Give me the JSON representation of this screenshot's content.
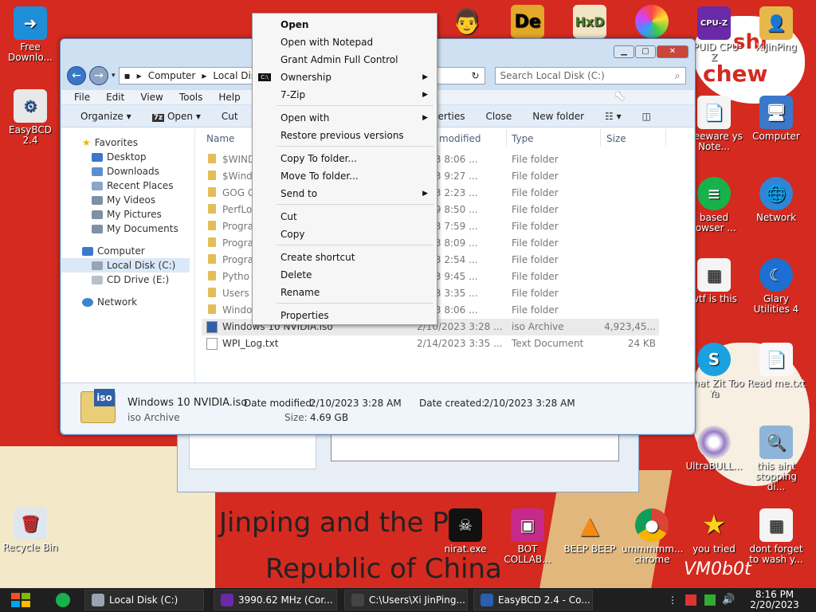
{
  "wallpaper": {
    "top_text_1": "shi",
    "top_text_2": "chew",
    "bottom_line_1": "Jinping and the P",
    "bottom_line_2": "Republic of China",
    "signature": "VM0b0t"
  },
  "desktop_icons": {
    "free_download": "Free Downlo...",
    "easybcd": "EasyBCD 2.4",
    "recycle_bin": "Recycle Bin",
    "cpuz": "CPUID CPU-Z",
    "xijinping": "XiJinPing",
    "freeware": "Freeware ys Note...",
    "computer": "Computer",
    "based_browser": "based rowser ...",
    "network": "Network",
    "wtf": "wtf is this",
    "glary": "Glary Utilities 4",
    "what_zit": "What Zit Too Ya",
    "readme": "Read me.txt",
    "ultrabull": "UltraBULL...",
    "this_aint": "this aint stopping di...",
    "nirat": "nirat.exe",
    "bot_collab": "BOT COLLAB...",
    "beep": "BEEP BEEP",
    "chrome": "ummmmm... chrome",
    "you_tried": "you tried",
    "dont_forget": "dont forget to wash y..."
  },
  "explorer": {
    "address": {
      "crumb1": "Computer",
      "crumb2": "Local Disk"
    },
    "search_placeholder": "Search Local Disk (C:)",
    "menu": {
      "file": "File",
      "edit": "Edit",
      "view": "View",
      "tools": "Tools",
      "help": "Help"
    },
    "toolbar": {
      "organize": "Organize",
      "open": "Open",
      "cut": "Cut",
      "properties": "operties",
      "close": "Close",
      "new_folder": "New folder"
    },
    "nav": {
      "favorites": "Favorites",
      "desktop": "Desktop",
      "downloads": "Downloads",
      "recent": "Recent Places",
      "videos": "My Videos",
      "pictures": "My Pictures",
      "documents": "My Documents",
      "computer": "Computer",
      "local_disk": "Local Disk (C:)",
      "cd_drive": "CD Drive (E:)",
      "network": "Network"
    },
    "columns": {
      "name": "Name",
      "modified": "modified",
      "type": "Type",
      "size": "Size"
    },
    "rows": [
      {
        "name": "$WIND",
        "date": "2023 8:06 ...",
        "type": "File folder",
        "size": ""
      },
      {
        "name": "$Windo",
        "date": "2023 9:27 ...",
        "type": "File folder",
        "size": ""
      },
      {
        "name": "GOG G",
        "date": "2023 2:23 ...",
        "type": "File folder",
        "size": ""
      },
      {
        "name": "PerfLo",
        "date": "2009 8:50 ...",
        "type": "File folder",
        "size": ""
      },
      {
        "name": "Progra",
        "date": "2023 7:59 ...",
        "type": "File folder",
        "size": ""
      },
      {
        "name": "Progra",
        "date": "2023 8:09 ...",
        "type": "File folder",
        "size": ""
      },
      {
        "name": "Progra",
        "date": "2023 2:54 ...",
        "type": "File folder",
        "size": ""
      },
      {
        "name": "Pytho",
        "date": "2023 9:45 ...",
        "type": "File folder",
        "size": ""
      },
      {
        "name": "Users",
        "date": "2023 3:35 ...",
        "type": "File folder",
        "size": ""
      },
      {
        "name": "Windo",
        "date": "2023 8:06 ...",
        "type": "File folder",
        "size": ""
      },
      {
        "name": "Windows 10 NVIDIA.iso",
        "date": "2/10/2023 3:28 ...",
        "type": "iso Archive",
        "size": "4,923,45..."
      },
      {
        "name": "WPI_Log.txt",
        "date": "2/14/2023 3:35 ...",
        "type": "Text Document",
        "size": "24 KB"
      }
    ],
    "details": {
      "filename": "Windows 10 NVIDIA.iso",
      "modified_label": "Date modified:",
      "modified_value": "2/10/2023 3:28 AM",
      "created_label": "Date created:",
      "created_value": "2/10/2023 3:28 AM",
      "type": "iso Archive",
      "size_label": "Size:",
      "size_value": "4.69 GB",
      "icon_text": "iso"
    }
  },
  "context_menu": {
    "open": "Open",
    "open_notepad": "Open with Notepad",
    "grant_admin": "Grant Admin Full Control",
    "ownership": "Ownership",
    "sevenzip": "7-Zip",
    "open_with": "Open with",
    "restore": "Restore previous versions",
    "copy_to": "Copy To folder...",
    "move_to": "Move To folder...",
    "send_to": "Send to",
    "cut": "Cut",
    "copy": "Copy",
    "create_shortcut": "Create shortcut",
    "delete": "Delete",
    "rename": "Rename",
    "properties": "Properties"
  },
  "taskbar": {
    "t1": "Local Disk (C:)",
    "t2": "3990.62 MHz (Cor...",
    "t3": "C:\\Users\\Xi JinPing...",
    "t4": "EasyBCD 2.4 - Co...",
    "time": "8:16 PM",
    "date": "2/20/2023"
  }
}
